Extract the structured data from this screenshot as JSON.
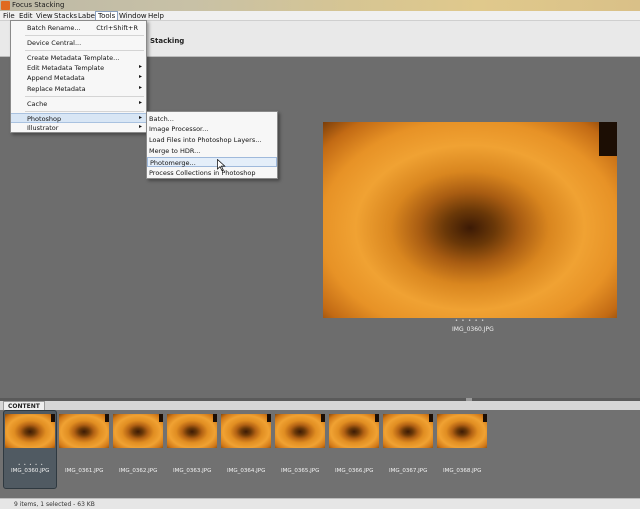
{
  "window": {
    "title": "Focus Stacking"
  },
  "menubar": [
    "File",
    "Edit",
    "View",
    "Stacks",
    "Label",
    "Tools",
    "Window",
    "Help"
  ],
  "toolbar": {
    "label": "Stacking"
  },
  "tools_menu": {
    "items": [
      {
        "label": "Batch Rename...",
        "shortcut": "Ctrl+Shift+R"
      },
      {
        "label": "Device Central..."
      },
      {
        "label": "Create Metadata Template..."
      },
      {
        "label": "Edit Metadata Template",
        "arrow": "▸"
      },
      {
        "label": "Append Metadata",
        "arrow": "▸"
      },
      {
        "label": "Replace Metadata",
        "arrow": "▸"
      },
      {
        "label": "Cache",
        "arrow": "▸"
      },
      {
        "label": "Photoshop",
        "arrow": "▸"
      },
      {
        "label": "Illustrator",
        "arrow": "▸"
      }
    ]
  },
  "photoshop_menu": {
    "items": [
      {
        "label": "Batch..."
      },
      {
        "label": "Image Processor..."
      },
      {
        "label": "Load Files into Photoshop Layers..."
      },
      {
        "label": "Merge to HDR..."
      },
      {
        "label": "Photomerge..."
      },
      {
        "label": "Process Collections in Photoshop"
      }
    ]
  },
  "preview": {
    "dots": "• • • • •",
    "filename": "IMG_0360.JPG"
  },
  "content": {
    "tab": "CONTENT",
    "dots": "• • • • •",
    "thumbnails": [
      "IMG_0360.JPG",
      "IMG_0361.JPG",
      "IMG_0362.JPG",
      "IMG_0363.JPG",
      "IMG_0364.JPG",
      "IMG_0365.JPG",
      "IMG_0366.JPG",
      "IMG_0367.JPG",
      "IMG_0368.JPG"
    ]
  },
  "status": {
    "text": "9 items, 1 selected - 63 KB"
  },
  "colors": {
    "menu_highlight": "#d8e6f5",
    "accent_orange": "#e06a20"
  }
}
